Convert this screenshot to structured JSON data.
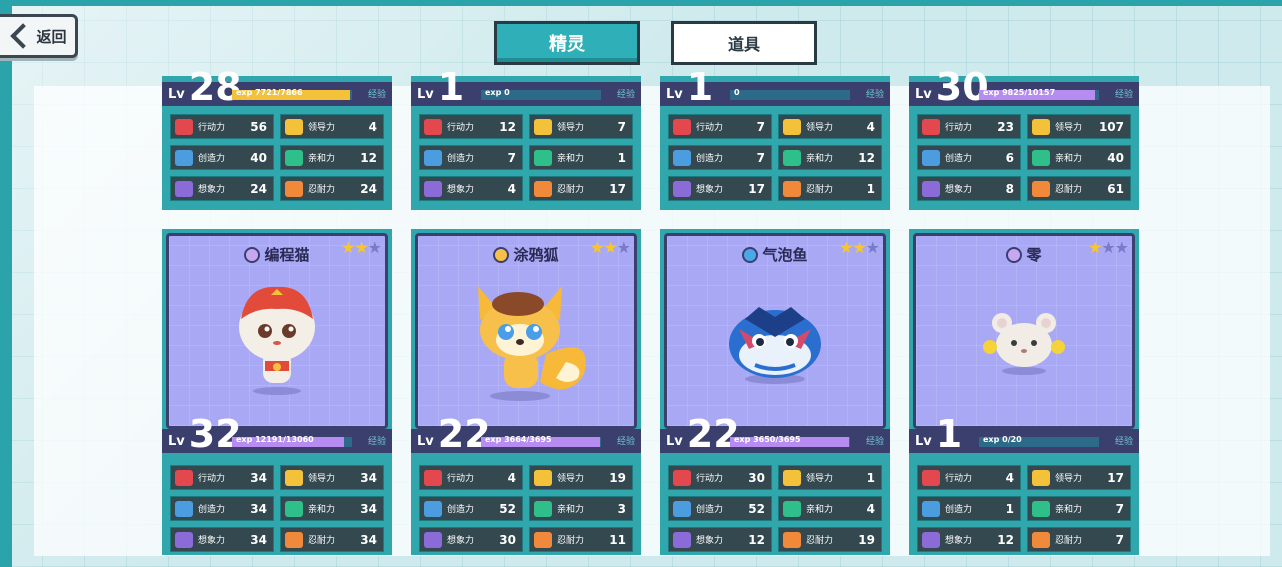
{
  "nav": {
    "back_label": "返回"
  },
  "tabs": [
    {
      "label": "精灵",
      "active": true
    },
    {
      "label": "道具",
      "active": false
    }
  ],
  "stat_icons": [
    "flag-icon",
    "sun-icon",
    "gear-icon",
    "smile-icon",
    "cloud-icon",
    "house-icon"
  ],
  "top_cards": [
    {
      "lv_label": "Lv",
      "level": "28",
      "exp_prefix": "exp",
      "exp_current": "7721",
      "exp_max": "/7866",
      "exp_label": "经验",
      "exp_fraction": 0.98,
      "exp_color": "#f3c23a",
      "stats": [
        [
          "行动力",
          "56"
        ],
        [
          "领导力",
          "4"
        ],
        [
          "创造力",
          "40"
        ],
        [
          "亲和力",
          "12"
        ],
        [
          "想象力",
          "24"
        ],
        [
          "忍耐力",
          "24"
        ]
      ]
    },
    {
      "lv_label": "Lv",
      "level": "1",
      "exp_prefix": "exp",
      "exp_current": "0",
      "exp_max": "",
      "exp_label": "经验",
      "exp_fraction": 0.0,
      "exp_color": "#f3c23a",
      "stats": [
        [
          "行动力",
          "12"
        ],
        [
          "领导力",
          "7"
        ],
        [
          "创造力",
          "7"
        ],
        [
          "亲和力",
          "1"
        ],
        [
          "想象力",
          "4"
        ],
        [
          "忍耐力",
          "17"
        ]
      ]
    },
    {
      "lv_label": "Lv",
      "level": "1",
      "exp_prefix": "",
      "exp_current": "0",
      "exp_max": "",
      "exp_label": "经验",
      "exp_fraction": 0.0,
      "exp_color": "#f3c23a",
      "stats": [
        [
          "行动力",
          "7"
        ],
        [
          "领导力",
          "4"
        ],
        [
          "创造力",
          "7"
        ],
        [
          "亲和力",
          "12"
        ],
        [
          "想象力",
          "17"
        ],
        [
          "忍耐力",
          "1"
        ]
      ]
    },
    {
      "lv_label": "Lv",
      "level": "30",
      "exp_prefix": "exp",
      "exp_current": "9825",
      "exp_max": "/10157",
      "exp_label": "经验",
      "exp_fraction": 0.97,
      "exp_color": "#b78cf0",
      "stats": [
        [
          "行动力",
          "23"
        ],
        [
          "领导力",
          "107"
        ],
        [
          "创造力",
          "6"
        ],
        [
          "亲和力",
          "40"
        ],
        [
          "想象力",
          "8"
        ],
        [
          "忍耐力",
          "61"
        ]
      ]
    }
  ],
  "bottom_cards": [
    {
      "name": "编程猫",
      "stars": 2,
      "creature": "cat",
      "lv_label": "Lv",
      "level": "32",
      "exp_prefix": "exp",
      "exp_current": "12191",
      "exp_max": "/13060",
      "exp_label": "经验",
      "exp_fraction": 0.93,
      "exp_color": "#b78cf0",
      "stats": [
        [
          "行动力",
          "34"
        ],
        [
          "领导力",
          "34"
        ],
        [
          "创造力",
          "34"
        ],
        [
          "亲和力",
          "34"
        ],
        [
          "想象力",
          "34"
        ],
        [
          "忍耐力",
          "34"
        ]
      ]
    },
    {
      "name": "涂鸦狐",
      "stars": 2,
      "creature": "fox",
      "lv_label": "Lv",
      "level": "22",
      "exp_prefix": "exp",
      "exp_current": "3664",
      "exp_max": "/3695",
      "exp_label": "经验",
      "exp_fraction": 0.99,
      "exp_color": "#b78cf0",
      "stats": [
        [
          "行动力",
          "4"
        ],
        [
          "领导力",
          "19"
        ],
        [
          "创造力",
          "52"
        ],
        [
          "亲和力",
          "3"
        ],
        [
          "想象力",
          "30"
        ],
        [
          "忍耐力",
          "11"
        ]
      ]
    },
    {
      "name": "气泡鱼",
      "stars": 2,
      "creature": "fish",
      "lv_label": "Lv",
      "level": "22",
      "exp_prefix": "exp",
      "exp_current": "3650",
      "exp_max": "/3695",
      "exp_label": "经验",
      "exp_fraction": 0.99,
      "exp_color": "#b78cf0",
      "stats": [
        [
          "行动力",
          "30"
        ],
        [
          "领导力",
          "1"
        ],
        [
          "创造力",
          "52"
        ],
        [
          "亲和力",
          "4"
        ],
        [
          "想象力",
          "12"
        ],
        [
          "忍耐力",
          "19"
        ]
      ]
    },
    {
      "name": "零",
      "stars": 1,
      "creature": "mouse",
      "lv_label": "Lv",
      "level": "1",
      "exp_prefix": "exp",
      "exp_current": "0",
      "exp_max": "/20",
      "exp_label": "经验",
      "exp_fraction": 0.0,
      "exp_color": "#b78cf0",
      "stats": [
        [
          "行动力",
          "4"
        ],
        [
          "领导力",
          "17"
        ],
        [
          "创造力",
          "1"
        ],
        [
          "亲和力",
          "7"
        ],
        [
          "想象力",
          "12"
        ],
        [
          "忍耐力",
          "7"
        ]
      ]
    }
  ],
  "colors": {
    "teal": "#2fa7ac",
    "panel_dark": "#33484f",
    "portrait_bg": "#a8a8f5",
    "star_on": "#f7c52c",
    "star_off": "#7a7acb"
  }
}
